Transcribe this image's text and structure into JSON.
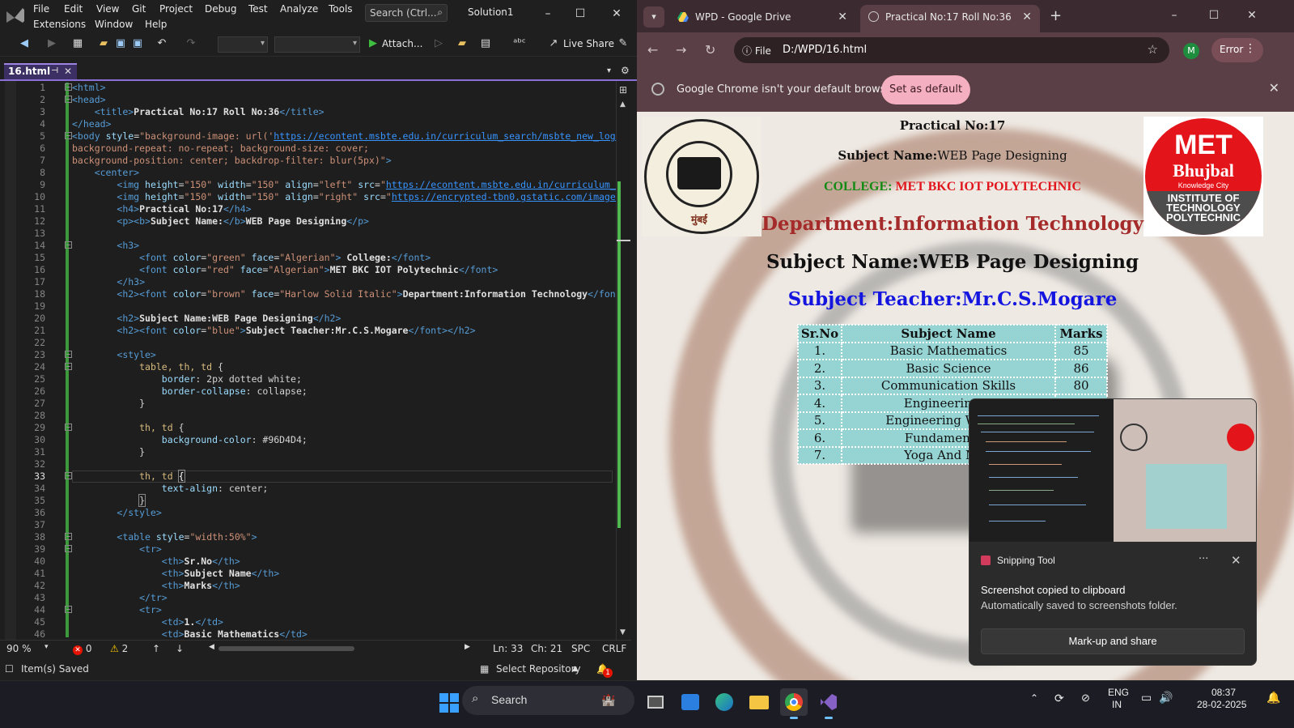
{
  "vs": {
    "menu": [
      "File",
      "Edit",
      "View",
      "Git",
      "Project",
      "Debug",
      "Test",
      "Analyze",
      "Tools",
      "Extensions",
      "Window",
      "Help"
    ],
    "search_placeholder": "Search (Ctrl...",
    "solution": "Solution1",
    "toolbar": {
      "attach": "Attach...",
      "live_share": "Live Share"
    },
    "tab": "16.html",
    "line_numbers": [
      "1",
      "2",
      "3",
      "4",
      "5",
      "6",
      "7",
      "8",
      "9",
      "10",
      "11",
      "12",
      "13",
      "14",
      "15",
      "16",
      "17",
      "18",
      "19",
      "20",
      "21",
      "22",
      "23",
      "24",
      "25",
      "26",
      "27",
      "28",
      "29",
      "30",
      "31",
      "32",
      "33",
      "34",
      "35",
      "36",
      "37",
      "38",
      "39",
      "40",
      "41",
      "42",
      "43",
      "44",
      "45",
      "46"
    ],
    "status": {
      "zoom": "90 %",
      "errors": "0",
      "warnings": "2",
      "ln": "Ln: 33",
      "ch": "Ch: 21",
      "spc": "SPC",
      "crlf": "CRLF"
    },
    "bottom": {
      "saved": "Item(s) Saved",
      "repo": "Select Repository",
      "notif": "1"
    }
  },
  "chrome": {
    "tabs": [
      {
        "title": "WPD - Google Drive"
      },
      {
        "title": "Practical No:17 Roll No:36"
      }
    ],
    "omnibox": {
      "scheme": "File",
      "url": "D:/WPD/16.html"
    },
    "avatar": "M",
    "error_label": "Error",
    "infobar": {
      "message": "Google Chrome isn't your default browser",
      "button": "Set as default"
    }
  },
  "page": {
    "logo_left_text": "मुंबई",
    "logo_right": {
      "met": "MET",
      "name": "Bhujbal",
      "sub": "Knowledge City",
      "inst": [
        "INSTITUTE OF",
        "TECHNOLOGY",
        "POLYTECHNIC"
      ]
    },
    "h4": "Practical No:17",
    "subject_label": "Subject Name:",
    "subject_value": "WEB Page Designing",
    "college_label": "COLLEGE:",
    "college_value": "MET BKC IOT POLYTECHNIC",
    "department": "Department:Information Technology",
    "subject_h2": "Subject Name:WEB Page Designing",
    "teacher": "Subject Teacher:Mr.C.S.Mogare",
    "table": {
      "headers": [
        "Sr.No",
        "Subject Name",
        "Marks"
      ],
      "rows": [
        [
          "1.",
          "Basic Mathematics",
          "85"
        ],
        [
          "2.",
          "Basic Science",
          "86"
        ],
        [
          "3.",
          "Communication Skills",
          "80"
        ],
        [
          "4.",
          "Engineering G",
          ""
        ],
        [
          "5.",
          "Engineering Worksh",
          ""
        ],
        [
          "6.",
          "Fundamentals",
          ""
        ],
        [
          "7.",
          "Yoga And Med",
          ""
        ]
      ]
    }
  },
  "snipping": {
    "app": "Snipping Tool",
    "line1": "Screenshot copied to clipboard",
    "line2": "Automatically saved to screenshots folder.",
    "button": "Mark-up and share"
  },
  "taskbar": {
    "search": "Search",
    "lang1": "ENG",
    "lang2": "IN",
    "time": "08:37",
    "date": "28-02-2025"
  }
}
